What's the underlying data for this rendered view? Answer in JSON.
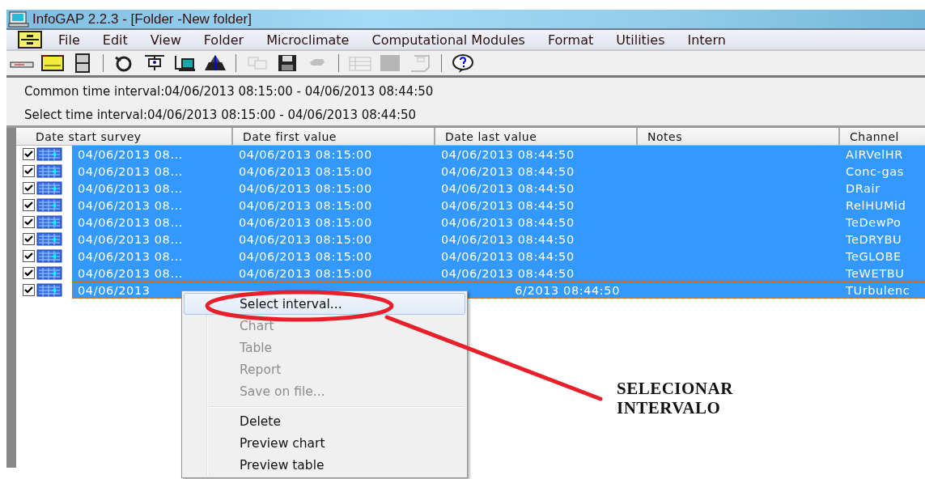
{
  "window": {
    "title": "InfoGAP 2.2.3 - [Folder -New folder]"
  },
  "menu_bar": [
    "File",
    "Edit",
    "View",
    "Folder",
    "Microclimate",
    "Computational Modules",
    "Format",
    "Utilities",
    "Intern"
  ],
  "toolbar": [
    {
      "kind": "tool",
      "disabled": false
    },
    {
      "kind": "tool",
      "disabled": false
    },
    {
      "kind": "tool",
      "disabled": false
    },
    {
      "kind": "separator"
    },
    {
      "kind": "tool",
      "disabled": false
    },
    {
      "kind": "tool",
      "disabled": false
    },
    {
      "kind": "tool",
      "disabled": false
    },
    {
      "kind": "tool",
      "disabled": false
    },
    {
      "kind": "separator"
    },
    {
      "kind": "tool",
      "disabled": true
    },
    {
      "kind": "tool",
      "disabled": false
    },
    {
      "kind": "tool",
      "disabled": true
    },
    {
      "kind": "separator"
    },
    {
      "kind": "tool",
      "disabled": true
    },
    {
      "kind": "tool",
      "disabled": true
    },
    {
      "kind": "tool",
      "disabled": true
    },
    {
      "kind": "separator"
    },
    {
      "kind": "tool",
      "disabled": false
    }
  ],
  "info": [
    "Common time interval:04/06/2013 08:15:00 - 04/06/2013 08:44:50",
    "Select time interval:04/06/2013 08:15:00 - 04/06/2013 08:44:50"
  ],
  "table": {
    "columns": [
      "Date start survey",
      "Date first value",
      "Date last value",
      "Notes",
      "Channel"
    ],
    "rows": [
      {
        "checked": true,
        "selected": true,
        "partly_covered": false,
        "cells": [
          "04/06/2013 08...",
          "04/06/2013 08:15:00",
          "04/06/2013 08:44:50",
          "",
          "AIRVelHR"
        ]
      },
      {
        "checked": true,
        "selected": true,
        "partly_covered": false,
        "cells": [
          "04/06/2013 08...",
          "04/06/2013 08:15:00",
          "04/06/2013 08:44:50",
          "",
          "Conc-gas"
        ]
      },
      {
        "checked": true,
        "selected": true,
        "partly_covered": false,
        "cells": [
          "04/06/2013 08...",
          "04/06/2013 08:15:00",
          "04/06/2013 08:44:50",
          "",
          "DRair"
        ]
      },
      {
        "checked": true,
        "selected": true,
        "partly_covered": false,
        "cells": [
          "04/06/2013 08...",
          "04/06/2013 08:15:00",
          "04/06/2013 08:44:50",
          "",
          "RelHUMid"
        ]
      },
      {
        "checked": true,
        "selected": true,
        "partly_covered": false,
        "cells": [
          "04/06/2013 08...",
          "04/06/2013 08:15:00",
          "04/06/2013 08:44:50",
          "",
          "TeDewPo"
        ]
      },
      {
        "checked": true,
        "selected": true,
        "partly_covered": false,
        "cells": [
          "04/06/2013 08...",
          "04/06/2013 08:15:00",
          "04/06/2013 08:44:50",
          "",
          "TeDRYBU"
        ]
      },
      {
        "checked": true,
        "selected": true,
        "partly_covered": false,
        "cells": [
          "04/06/2013 08...",
          "04/06/2013 08:15:00",
          "04/06/2013 08:44:50",
          "",
          "TeGLOBE"
        ]
      },
      {
        "checked": true,
        "selected": true,
        "partly_covered": false,
        "cells": [
          "04/06/2013 08...",
          "04/06/2013 08:15:00",
          "04/06/2013 08:44:50",
          "",
          "TeWETBU"
        ]
      },
      {
        "checked": true,
        "selected": true,
        "partly_covered": true,
        "cells": [
          "04/06/2013",
          "",
          "6/2013 08:44:50",
          "",
          "TUrbulenc"
        ]
      }
    ]
  },
  "context_menu": [
    {
      "label": "Select interval...",
      "disabled": false,
      "selected": true,
      "separator_before": false
    },
    {
      "label": "Chart",
      "disabled": true,
      "selected": false,
      "separator_before": false
    },
    {
      "label": "Table",
      "disabled": true,
      "selected": false,
      "separator_before": false
    },
    {
      "label": "Report",
      "disabled": true,
      "selected": false,
      "separator_before": false
    },
    {
      "label": "Save on file...",
      "disabled": true,
      "selected": false,
      "separator_before": false
    },
    {
      "label": "Delete",
      "disabled": false,
      "selected": false,
      "separator_before": true
    },
    {
      "label": "Preview chart",
      "disabled": false,
      "selected": false,
      "separator_before": false
    },
    {
      "label": "Preview table",
      "disabled": false,
      "selected": false,
      "separator_before": false
    }
  ],
  "annotation": {
    "lines": [
      "SELECIONAR",
      "INTERVALO"
    ]
  }
}
